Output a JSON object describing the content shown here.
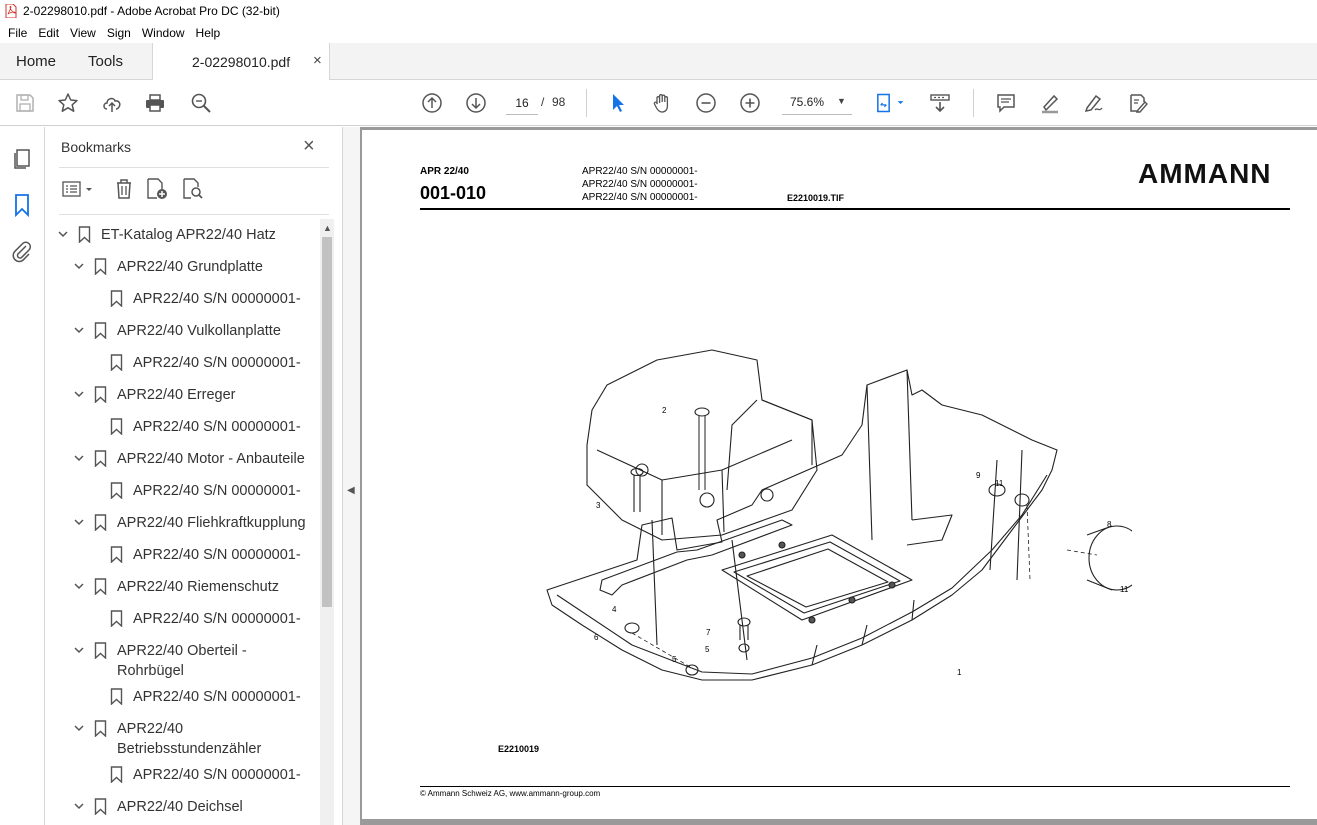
{
  "window": {
    "title": "2-02298010.pdf - Adobe Acrobat Pro DC (32-bit)"
  },
  "menu": [
    "File",
    "Edit",
    "View",
    "Sign",
    "Window",
    "Help"
  ],
  "tabs": {
    "home": "Home",
    "tools": "Tools",
    "document": "2-02298010.pdf",
    "close_glyph": "×"
  },
  "toolbar": {
    "current_page": "16",
    "page_separator": "/",
    "total_pages": "98",
    "zoom": "75.6%",
    "accent_color": "#1473e6"
  },
  "bookmarks": {
    "title": "Bookmarks",
    "close_glyph": "×",
    "items": [
      {
        "label": "ET-Katalog APR22/40 Hatz",
        "level": 0,
        "expanded": true
      },
      {
        "label": "APR22/40 Grundplatte",
        "level": 1,
        "expanded": true
      },
      {
        "label": "APR22/40 S/N 00000001-",
        "level": 2
      },
      {
        "label": "APR22/40 Vulkollanplatte",
        "level": 1,
        "expanded": true
      },
      {
        "label": "APR22/40 S/N 00000001-",
        "level": 2
      },
      {
        "label": "APR22/40 Erreger",
        "level": 1,
        "expanded": true
      },
      {
        "label": "APR22/40 S/N 00000001-",
        "level": 2
      },
      {
        "label": "APR22/40 Motor - Anbauteile",
        "level": 1,
        "expanded": true
      },
      {
        "label": "APR22/40 S/N 00000001-",
        "level": 2
      },
      {
        "label": "APR22/40 Fliehkraftkupplung",
        "level": 1,
        "expanded": true
      },
      {
        "label": "APR22/40 S/N 00000001-",
        "level": 2
      },
      {
        "label": "APR22/40 Riemenschutz",
        "level": 1,
        "expanded": true
      },
      {
        "label": "APR22/40 S/N 00000001-",
        "level": 2
      },
      {
        "label": "APR22/40 Oberteil -",
        "label2": "Rohrbügel",
        "level": 1,
        "expanded": true
      },
      {
        "label": "APR22/40 S/N 00000001-",
        "level": 2
      },
      {
        "label": "APR22/40",
        "label2": "Betriebsstundenzähler",
        "level": 1,
        "expanded": true
      },
      {
        "label": "APR22/40 S/N 00000001-",
        "level": 2
      },
      {
        "label": "APR22/40 Deichsel",
        "level": 1,
        "expanded": true
      }
    ]
  },
  "document": {
    "model": "APR 22/40",
    "code": "001-010",
    "serials": [
      "APR22/40 S/N 00000001-",
      "APR22/40 S/N 00000001-",
      "APR22/40 S/N 00000001-"
    ],
    "tif_name": "E2210019.TIF",
    "logo": "AMMANN",
    "drawing_ref": "E2210019",
    "part_numbers": [
      "1",
      "2",
      "3",
      "4",
      "5",
      "5",
      "6",
      "7",
      "8",
      "9",
      "10",
      "11",
      "11"
    ],
    "copyright": "© Ammann Schweiz AG, www.ammann-group.com"
  }
}
